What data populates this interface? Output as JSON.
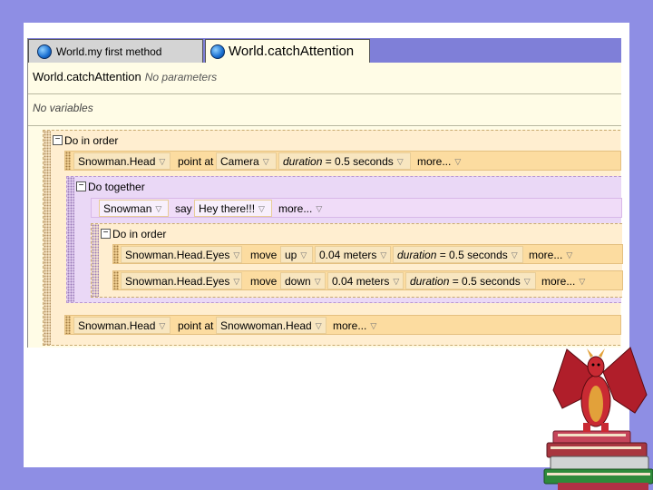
{
  "tabs": [
    {
      "label": "World.my first method",
      "active": false
    },
    {
      "label": "World.catchAttention",
      "active": true
    }
  ],
  "method": {
    "name": "World.catchAttention",
    "params": "No parameters",
    "vars": "No variables"
  },
  "blocks": {
    "do_in_order": "Do in order",
    "row1": {
      "obj": "Snowman.Head",
      "cmd": "point at",
      "target": "Camera",
      "dur_label": "duration",
      "dur_val": "= 0.5 seconds",
      "more": "more..."
    },
    "do_together": "Do together",
    "say": {
      "obj": "Snowman",
      "cmd": "say",
      "text": "Hey there!!!",
      "more": "more..."
    },
    "inner_order": "Do in order",
    "move1": {
      "obj": "Snowman.Head.Eyes",
      "cmd": "move",
      "dir": "up",
      "amount": "0.04 meters",
      "dur_label": "duration",
      "dur_val": "= 0.5 seconds",
      "more": "more..."
    },
    "move2": {
      "obj": "Snowman.Head.Eyes",
      "cmd": "move",
      "dir": "down",
      "amount": "0.04 meters",
      "dur_label": "duration",
      "dur_val": "= 0.5 seconds",
      "more": "more..."
    },
    "row_last": {
      "obj": "Snowman.Head",
      "cmd": "point at",
      "target": "Snowwoman.Head",
      "more": "more..."
    }
  },
  "colors": {
    "background": "#8e8ee4",
    "editor": "#fffce6",
    "do_in_order": "#ffeed0",
    "do_together": "#ead8f6",
    "command_row": "#fcdca0"
  },
  "icons": {
    "tab": "globe-icon",
    "dropdown": "dropdown-arrow-icon",
    "collapse": "minus-box-icon",
    "decoration": "dragon-on-books"
  }
}
